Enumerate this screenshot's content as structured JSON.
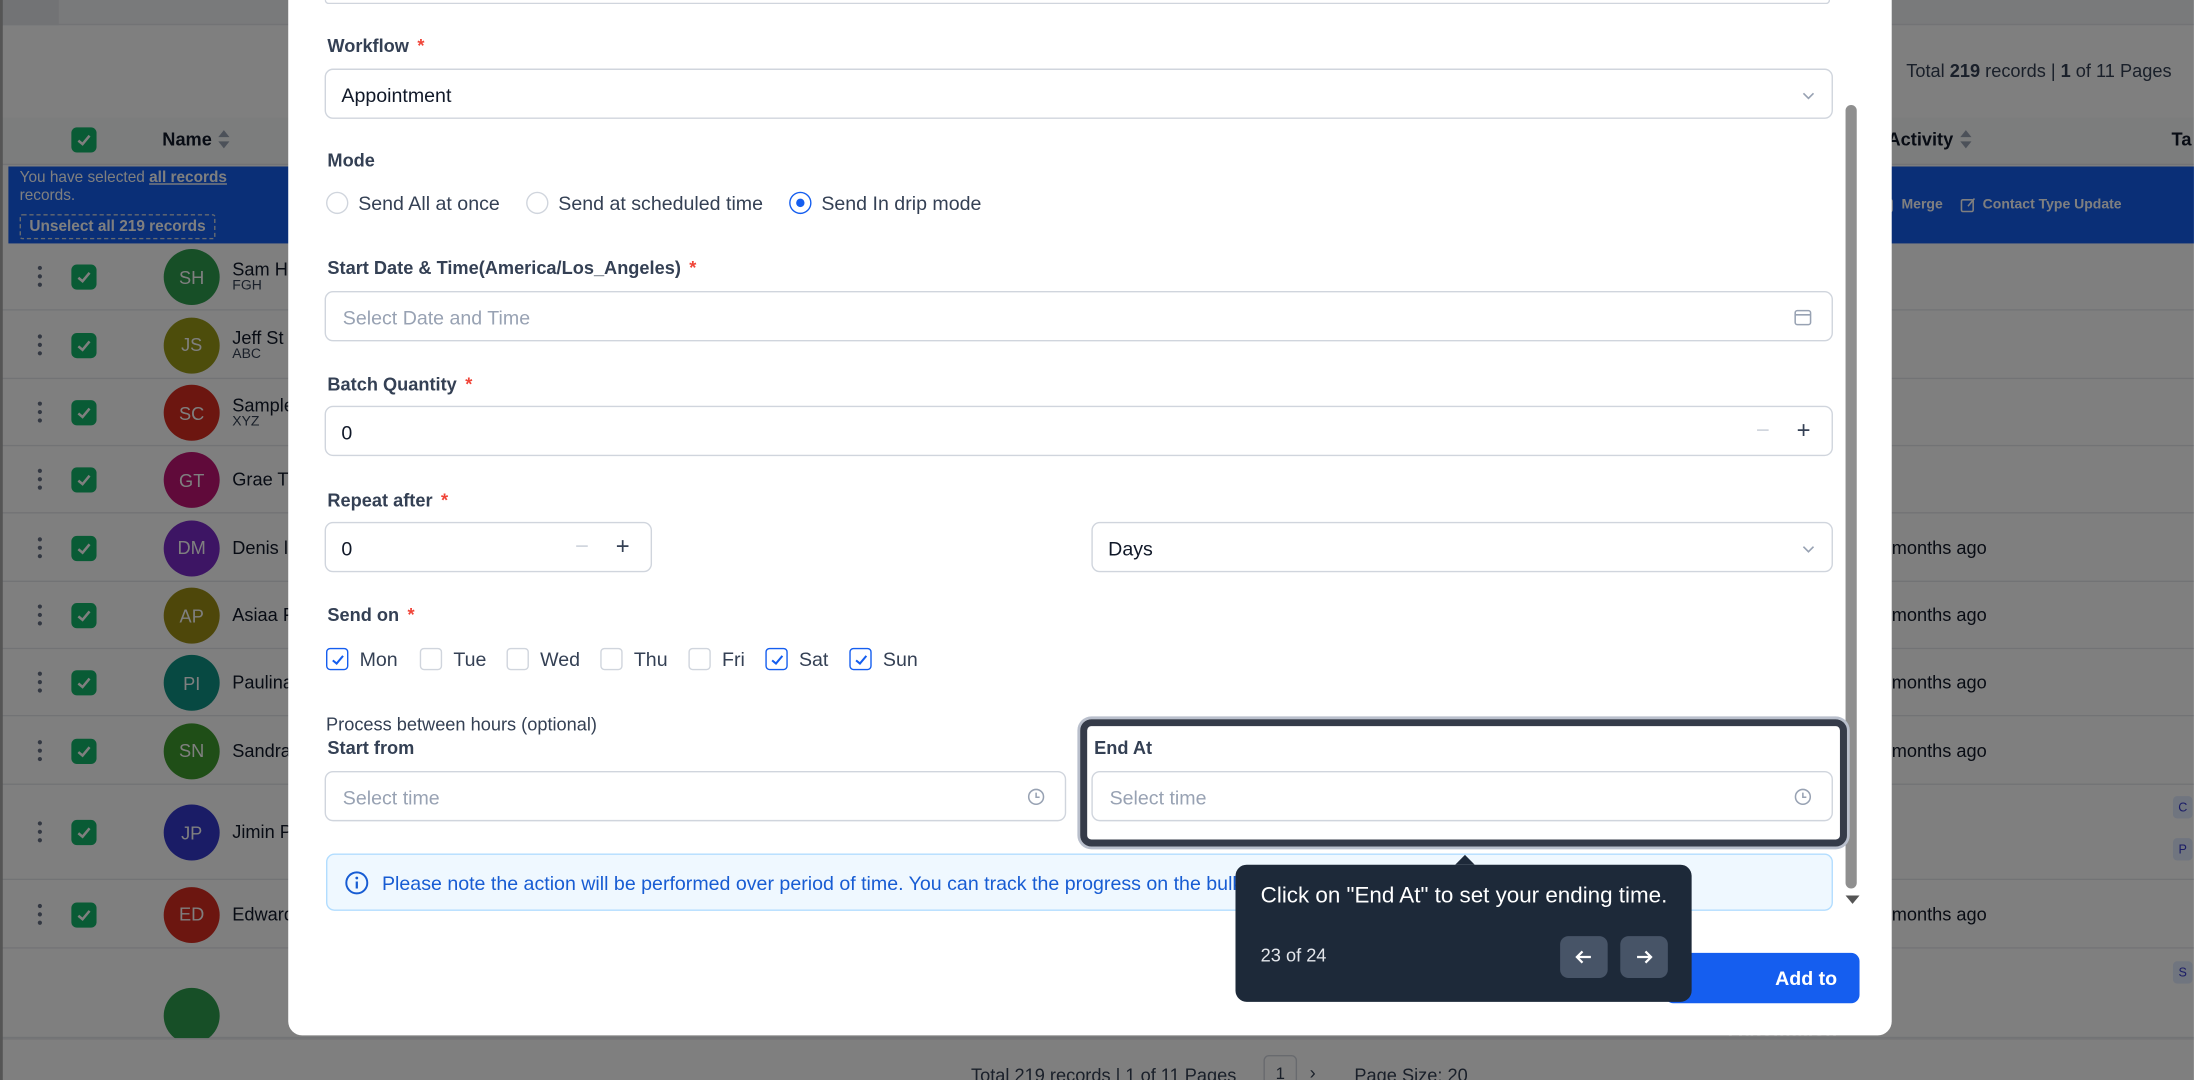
{
  "background": {
    "total_prefix": "Total ",
    "total_records": "219",
    "total_mid": " records | ",
    "total_page": "1",
    "total_suffix": " of 11 Pages",
    "columns": {
      "name": "Name",
      "activity": "Activity",
      "tags": "Ta"
    },
    "banner": {
      "text_before": "You have selected ",
      "link": "all records",
      "text_after": " records.",
      "unselect": "Unselect all 219 records",
      "actions": [
        "Merge",
        "Contact Type Update"
      ]
    },
    "rows": [
      {
        "initials": "SH",
        "name": "Sam H",
        "sub": "FGH",
        "color": "#2e9e4f",
        "activity": ""
      },
      {
        "initials": "JS",
        "name": "Jeff St",
        "sub": "ABC",
        "color": "#9a9a17",
        "activity": ""
      },
      {
        "initials": "SC",
        "name": "Sample",
        "sub": "XYZ",
        "color": "#d92d20",
        "activity": ""
      },
      {
        "initials": "GT",
        "name": "Grae T",
        "sub": "",
        "color": "#c11574",
        "activity": ""
      },
      {
        "initials": "DM",
        "name": "Denis l",
        "sub": "",
        "color": "#7a2bc9",
        "activity": "months ago"
      },
      {
        "initials": "AP",
        "name": "Asiaa F",
        "sub": "",
        "color": "#9c8f14",
        "activity": "months ago"
      },
      {
        "initials": "PI",
        "name": "Paulina",
        "sub": "",
        "color": "#0e9384",
        "activity": "months ago"
      },
      {
        "initials": "SN",
        "name": "Sandra",
        "sub": "",
        "color": "#3f9c2f",
        "activity": "months ago"
      },
      {
        "initials": "JP",
        "name": "Jimin P",
        "sub": "",
        "color": "#3538cd",
        "activity": ""
      },
      {
        "initials": "ED",
        "name": "Edward",
        "sub": "",
        "color": "#d92d20",
        "activity": "months ago"
      }
    ],
    "footer": {
      "text": "Total 219 records | 1 of 11 Pages",
      "page": "1",
      "page_size": "Page Size: 20"
    }
  },
  "modal": {
    "workflow": {
      "label": "Workflow",
      "required": "*",
      "value": "Appointment"
    },
    "mode": {
      "label": "Mode",
      "options": [
        "Send All at once",
        "Send at scheduled time",
        "Send In drip mode"
      ],
      "selected": "Send In drip mode"
    },
    "start_date": {
      "label": "Start Date & Time(America/Los_Angeles)",
      "required": "*",
      "placeholder": "Select Date and Time"
    },
    "batch": {
      "label": "Batch Quantity",
      "required": "*",
      "value": "0"
    },
    "repeat": {
      "label": "Repeat after",
      "required": "*",
      "value": "0",
      "unit": "Days"
    },
    "send_on": {
      "label": "Send on",
      "required": "*",
      "days": [
        {
          "label": "Mon",
          "checked": true
        },
        {
          "label": "Tue",
          "checked": false
        },
        {
          "label": "Wed",
          "checked": false
        },
        {
          "label": "Thu",
          "checked": false
        },
        {
          "label": "Fri",
          "checked": false
        },
        {
          "label": "Sat",
          "checked": true
        },
        {
          "label": "Sun",
          "checked": true
        }
      ]
    },
    "hours": {
      "label": "Process between hours (optional)",
      "start_label": "Start from",
      "start_placeholder": "Select time",
      "end_label": "End At",
      "end_placeholder": "Select time"
    },
    "info_text": "Please note the action will be performed over period of time. You can track the progress on the bulk a",
    "add_button": "Add to Automation"
  },
  "tour": {
    "text": "Click on \"End At\" to set your ending time.",
    "step": "23 of 24"
  },
  "colors": {
    "primary": "#155eef",
    "tooltip_bg": "#1d2939",
    "required": "#f04438"
  }
}
